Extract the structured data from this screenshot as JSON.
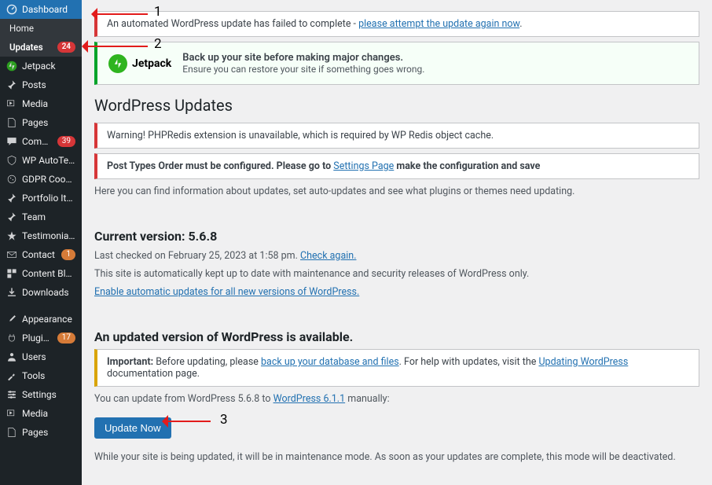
{
  "annotations": {
    "n1": "1",
    "n2": "2",
    "n3": "3"
  },
  "sidebar": {
    "dashboard": "Dashboard",
    "home": "Home",
    "updates": "Updates",
    "updates_count": "24",
    "items": [
      {
        "label": "Jetpack",
        "icon": "jetpack"
      },
      {
        "label": "Posts",
        "icon": "pin"
      },
      {
        "label": "Media",
        "icon": "media"
      },
      {
        "label": "Pages",
        "icon": "page"
      },
      {
        "label": "Comments",
        "icon": "comment",
        "badge": "39"
      },
      {
        "label": "WP AutoTerms",
        "icon": "shield"
      },
      {
        "label": "GDPR Cookie Consent",
        "icon": "cookie"
      },
      {
        "label": "Portfolio Items",
        "icon": "pin"
      },
      {
        "label": "Team",
        "icon": "pin"
      },
      {
        "label": "Testimonials",
        "icon": "star"
      },
      {
        "label": "Contact",
        "icon": "mail",
        "badge": "1",
        "badge_color": "orange"
      },
      {
        "label": "Content Blocks",
        "icon": "blocks"
      },
      {
        "label": "Downloads",
        "icon": "download"
      },
      {
        "label": "Appearance",
        "icon": "brush"
      },
      {
        "label": "Plugins",
        "icon": "plug",
        "badge": "17",
        "badge_color": "orange"
      },
      {
        "label": "Users",
        "icon": "user"
      },
      {
        "label": "Tools",
        "icon": "wrench"
      },
      {
        "label": "Settings",
        "icon": "sliders"
      },
      {
        "label": "Media",
        "icon": "media"
      },
      {
        "label": "Pages",
        "icon": "page"
      }
    ]
  },
  "notices": {
    "update_failed_a": "An automated WordPress update has failed to complete - ",
    "update_failed_link": "please attempt the update again now",
    "jetpack_brand": "Jetpack",
    "jetpack_title": "Back up your site before making major changes.",
    "jetpack_sub": "Ensure you can restore your site if something goes wrong.",
    "phpredis": "Warning! PHPRedis extension is unavailable, which is required by WP Redis object cache.",
    "pto_a": "Post Types Order must be configured. Please go to ",
    "pto_link": "Settings Page",
    "pto_b": " make the configuration and save",
    "important_label": "Important:",
    "important_a": " Before updating, please ",
    "important_link1": "back up your database and files",
    "important_b": ". For help with updates, visit the ",
    "important_link2": "Updating WordPress",
    "important_c": " documentation page."
  },
  "page": {
    "title": "WordPress Updates",
    "intro": "Here you can find information about updates, set auto-updates and see what plugins or themes need updating.",
    "current_version_h": "Current version: 5.6.8",
    "last_checked": "Last checked on February 25, 2023 at 1:58 pm. ",
    "check_again": "Check again.",
    "auto_text": "This site is automatically kept up to date with maintenance and security releases of WordPress only.",
    "enable_auto": "Enable automatic updates for all new versions of WordPress.",
    "update_available_h": "An updated version of WordPress is available.",
    "update_from_a": "You can update from WordPress 5.6.8 to ",
    "update_from_link": "WordPress 6.1.1",
    "update_from_b": " manually:",
    "update_now_btn": "Update Now",
    "maintenance": "While your site is being updated, it will be in maintenance mode. As soon as your updates are complete, this mode will be deactivated."
  }
}
